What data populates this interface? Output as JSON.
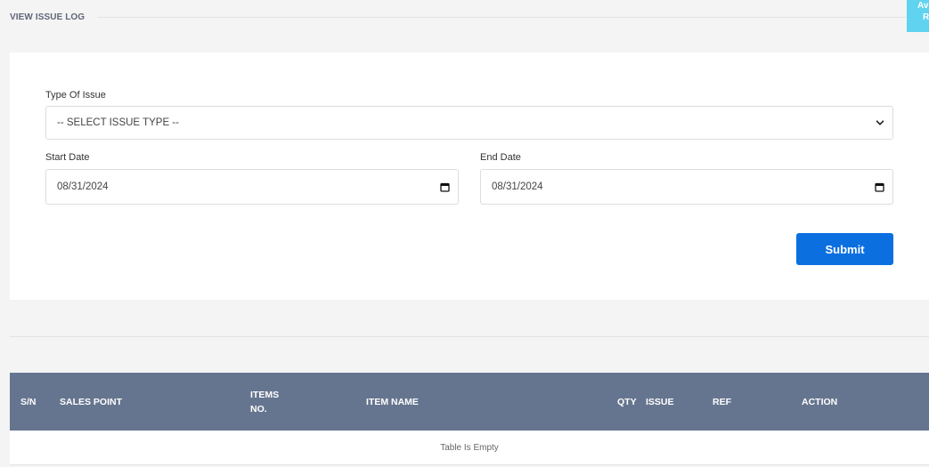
{
  "header": {
    "title": "VIEW ISSUE LOG",
    "corner_badge": [
      "Av",
      "R"
    ]
  },
  "form": {
    "issue_type": {
      "label": "Type Of Issue",
      "selected": "-- SELECT ISSUE TYPE --"
    },
    "start_date": {
      "label": "Start Date",
      "value": "08/31/2024"
    },
    "end_date": {
      "label": "End Date",
      "value": "08/31/2024"
    },
    "submit_label": "Submit"
  },
  "table": {
    "columns": {
      "sn": "S/N",
      "sales_point": "SALES POINT",
      "items_no": [
        "ITEMS",
        "NO."
      ],
      "item_name": "ITEM NAME",
      "qty": "QTY",
      "issue": "ISSUE",
      "ref": "REF",
      "action": "ACTION"
    },
    "empty_message": "Table Is Empty"
  },
  "colors": {
    "accent": "#0b6fe0",
    "table_header": "#66758f",
    "badge": "#5fd3ef"
  }
}
